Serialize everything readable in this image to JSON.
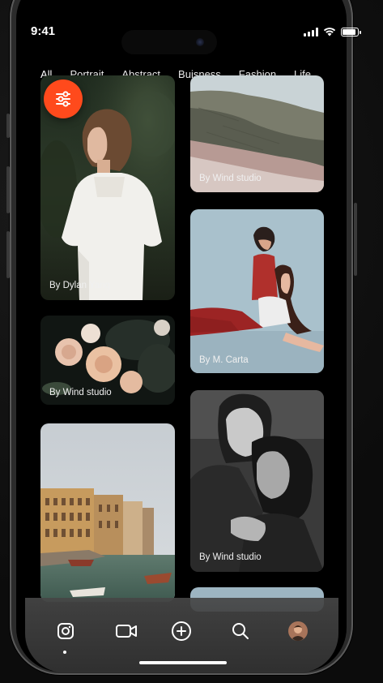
{
  "status": {
    "time": "9:41"
  },
  "tabs": [
    {
      "label": "All",
      "active": true
    },
    {
      "label": "Portrait"
    },
    {
      "label": "Abstract"
    },
    {
      "label": "Buisness"
    },
    {
      "label": "Fashion"
    },
    {
      "label": "Life"
    }
  ],
  "cards": {
    "woman_white_dress": {
      "credit": "By Dylan Yang"
    },
    "cliff_landscape": {
      "credit": "By Wind studio"
    },
    "couple_blue": {
      "credit": "By M. Carta"
    },
    "roses": {
      "credit": "By Wind studio"
    },
    "women_bw": {
      "credit": "By Wind studio"
    }
  },
  "nav": {
    "items": [
      "instagram-icon",
      "video-camera-icon",
      "plus-circle-icon",
      "search-icon",
      "avatar"
    ]
  },
  "colors": {
    "accent": "#ff4a1c",
    "background": "#000000"
  }
}
